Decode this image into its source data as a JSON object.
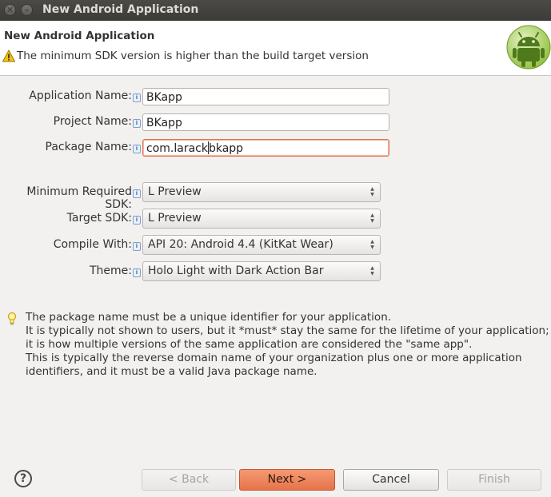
{
  "window": {
    "title": "New Android Application"
  },
  "banner": {
    "title": "New Android Application",
    "warning": "The minimum SDK version is higher than the build target version"
  },
  "form": {
    "app_name": {
      "label": "Application Name:",
      "value": "BKapp"
    },
    "project_name": {
      "label": "Project Name:",
      "value": "BKapp"
    },
    "package_name": {
      "label": "Package Name:",
      "value_before_caret": "com.larack",
      "value_after_caret": "bkapp"
    },
    "min_sdk": {
      "label": "Minimum Required SDK:",
      "value": "L Preview"
    },
    "target_sdk": {
      "label": "Target SDK:",
      "value": "L Preview"
    },
    "compile_with": {
      "label": "Compile With:",
      "value": "API 20: Android 4.4 (KitKat Wear)"
    },
    "theme": {
      "label": "Theme:",
      "value": "Holo Light with Dark Action Bar"
    }
  },
  "help_text": [
    "The package name must be a unique identifier for your application.",
    "It is typically not shown to users, but it *must* stay the same for the lifetime of your application;",
    "it is how multiple versions of the same application are considered the \"same app\".",
    "This is typically the reverse domain name of your organization plus one or more application",
    "identifiers, and it must be a valid Java package name."
  ],
  "buttons": {
    "help": "?",
    "back": "< Back",
    "next": "Next >",
    "cancel": "Cancel",
    "finish": "Finish"
  },
  "icons": {
    "close": "close-icon",
    "minimize": "minimize-icon",
    "warning": "warning-icon",
    "info": "info-icon",
    "bulb": "lightbulb-icon",
    "android": "android-logo"
  }
}
